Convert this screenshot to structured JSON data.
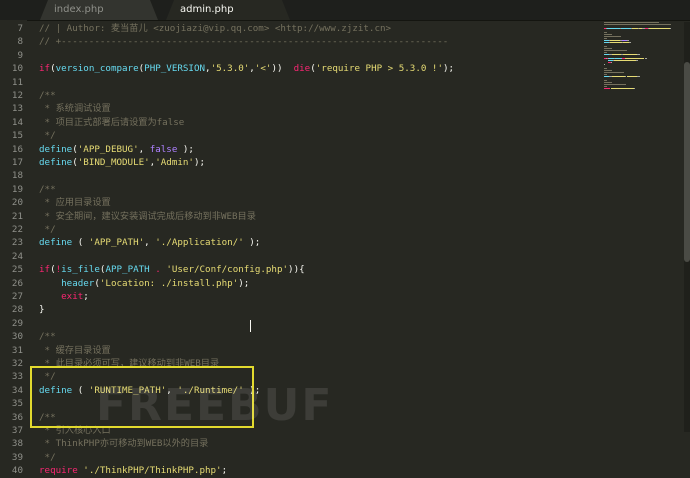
{
  "tabs": [
    {
      "label": "index.php",
      "active": false
    },
    {
      "label": "admin.php",
      "active": true
    }
  ],
  "lines": [
    {
      "n": "7",
      "tokens": [
        {
          "t": "// | Author: 麦当苗儿 <zuojiazi@vip.qq.com> <http://www.zjzit.cn>",
          "c": "c"
        }
      ]
    },
    {
      "n": "8",
      "tokens": [
        {
          "t": "// +----------------------------------------------------------------------",
          "c": "c"
        }
      ]
    },
    {
      "n": "9",
      "tokens": []
    },
    {
      "n": "10",
      "tokens": [
        {
          "t": "if",
          "c": "k"
        },
        {
          "t": "(",
          "c": "p"
        },
        {
          "t": "version_compare",
          "c": "f"
        },
        {
          "t": "(",
          "c": "p"
        },
        {
          "t": "PHP_VERSION",
          "c": "f"
        },
        {
          "t": ",",
          "c": "p"
        },
        {
          "t": "'5.3.0'",
          "c": "s"
        },
        {
          "t": ",",
          "c": "p"
        },
        {
          "t": "'<'",
          "c": "s"
        },
        {
          "t": "))  ",
          "c": "p"
        },
        {
          "t": "die",
          "c": "k"
        },
        {
          "t": "(",
          "c": "p"
        },
        {
          "t": "'require PHP > 5.3.0 !'",
          "c": "s"
        },
        {
          "t": ");",
          "c": "p"
        }
      ]
    },
    {
      "n": "11",
      "tokens": []
    },
    {
      "n": "12",
      "tokens": [
        {
          "t": "/**",
          "c": "c"
        }
      ]
    },
    {
      "n": "13",
      "tokens": [
        {
          "t": " * 系统调试设置",
          "c": "c"
        }
      ]
    },
    {
      "n": "14",
      "tokens": [
        {
          "t": " * 项目正式部署后请设置为false",
          "c": "c"
        }
      ]
    },
    {
      "n": "15",
      "tokens": [
        {
          "t": " */",
          "c": "c"
        }
      ]
    },
    {
      "n": "16",
      "tokens": [
        {
          "t": "define",
          "c": "f"
        },
        {
          "t": "(",
          "c": "p"
        },
        {
          "t": "'APP_DEBUG'",
          "c": "s"
        },
        {
          "t": ", ",
          "c": "p"
        },
        {
          "t": "false",
          "c": "b"
        },
        {
          "t": " );",
          "c": "p"
        }
      ]
    },
    {
      "n": "17",
      "tokens": [
        {
          "t": "define",
          "c": "f"
        },
        {
          "t": "(",
          "c": "p"
        },
        {
          "t": "'BIND_MODULE'",
          "c": "s"
        },
        {
          "t": ",",
          "c": "p"
        },
        {
          "t": "'Admin'",
          "c": "s"
        },
        {
          "t": ");",
          "c": "p"
        }
      ]
    },
    {
      "n": "18",
      "tokens": []
    },
    {
      "n": "19",
      "tokens": [
        {
          "t": "/**",
          "c": "c"
        }
      ]
    },
    {
      "n": "20",
      "tokens": [
        {
          "t": " * 应用目录设置",
          "c": "c"
        }
      ]
    },
    {
      "n": "21",
      "tokens": [
        {
          "t": " * 安全期间，建议安装调试完成后移动到非WEB目录",
          "c": "c"
        }
      ]
    },
    {
      "n": "22",
      "tokens": [
        {
          "t": " */",
          "c": "c"
        }
      ]
    },
    {
      "n": "23",
      "tokens": [
        {
          "t": "define",
          "c": "f"
        },
        {
          "t": " ( ",
          "c": "p"
        },
        {
          "t": "'APP_PATH'",
          "c": "s"
        },
        {
          "t": ", ",
          "c": "p"
        },
        {
          "t": "'./Application/'",
          "c": "s"
        },
        {
          "t": " );",
          "c": "p"
        }
      ]
    },
    {
      "n": "24",
      "tokens": []
    },
    {
      "n": "25",
      "tokens": [
        {
          "t": "if",
          "c": "k"
        },
        {
          "t": "(",
          "c": "p"
        },
        {
          "t": "!",
          "c": "k"
        },
        {
          "t": "is_file",
          "c": "f"
        },
        {
          "t": "(",
          "c": "p"
        },
        {
          "t": "APP_PATH",
          "c": "f"
        },
        {
          "t": " . ",
          "c": "k"
        },
        {
          "t": "'User/Conf/config.php'",
          "c": "s"
        },
        {
          "t": ")){",
          "c": "p"
        }
      ]
    },
    {
      "n": "26",
      "tokens": [
        {
          "t": "    ",
          "c": "p"
        },
        {
          "t": "header",
          "c": "f"
        },
        {
          "t": "(",
          "c": "p"
        },
        {
          "t": "'Location: ./install.php'",
          "c": "s"
        },
        {
          "t": ");",
          "c": "p"
        }
      ]
    },
    {
      "n": "27",
      "tokens": [
        {
          "t": "    ",
          "c": "p"
        },
        {
          "t": "exit",
          "c": "k"
        },
        {
          "t": ";",
          "c": "p"
        }
      ]
    },
    {
      "n": "28",
      "tokens": [
        {
          "t": "}",
          "c": "p"
        }
      ]
    },
    {
      "n": "29",
      "tokens": []
    },
    {
      "n": "30",
      "tokens": [
        {
          "t": "/**",
          "c": "c"
        }
      ]
    },
    {
      "n": "31",
      "tokens": [
        {
          "t": " * 缓存目录设置",
          "c": "c"
        }
      ]
    },
    {
      "n": "32",
      "tokens": [
        {
          "t": " * 此目录必须可写，建议移动到非WEB目录",
          "c": "c"
        }
      ]
    },
    {
      "n": "33",
      "tokens": [
        {
          "t": " */",
          "c": "c"
        }
      ]
    },
    {
      "n": "34",
      "tokens": [
        {
          "t": "define",
          "c": "f"
        },
        {
          "t": " ( ",
          "c": "p"
        },
        {
          "t": "'RUNTIME_PATH'",
          "c": "s"
        },
        {
          "t": ", ",
          "c": "p"
        },
        {
          "t": "'./Runtime/'",
          "c": "s"
        },
        {
          "t": " );",
          "c": "p"
        }
      ]
    },
    {
      "n": "35",
      "tokens": []
    },
    {
      "n": "36",
      "tokens": [
        {
          "t": "/**",
          "c": "c"
        }
      ]
    },
    {
      "n": "37",
      "tokens": [
        {
          "t": " * 引入核心入口",
          "c": "c"
        }
      ]
    },
    {
      "n": "38",
      "tokens": [
        {
          "t": " * ThinkPHP亦可移动到WEB以外的目录",
          "c": "c"
        }
      ]
    },
    {
      "n": "39",
      "tokens": [
        {
          "t": " */",
          "c": "c"
        }
      ]
    },
    {
      "n": "40",
      "tokens": [
        {
          "t": "require",
          "c": "k"
        },
        {
          "t": " ",
          "c": "p"
        },
        {
          "t": "'./ThinkPHP/ThinkPHP.php'",
          "c": "s"
        },
        {
          "t": ";",
          "c": "p"
        }
      ]
    }
  ],
  "watermark": "FREEBUF"
}
